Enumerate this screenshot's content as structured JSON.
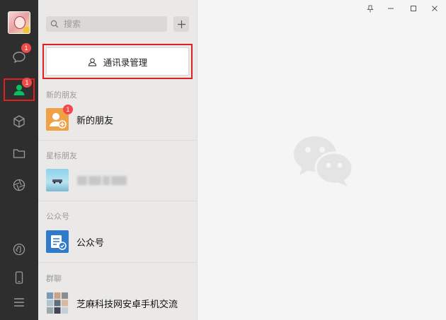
{
  "rail": {
    "items": [
      {
        "name": "chat",
        "badge": "1"
      },
      {
        "name": "contacts",
        "badge": "1",
        "active": true
      },
      {
        "name": "collections"
      },
      {
        "name": "files"
      },
      {
        "name": "moments"
      },
      {
        "name": "mini-programs"
      },
      {
        "name": "phone"
      },
      {
        "name": "menu"
      }
    ]
  },
  "search": {
    "placeholder": "搜索"
  },
  "manage_button": {
    "label": "通讯录管理"
  },
  "sections": [
    {
      "title": "新的朋友",
      "items": [
        {
          "label": "新的朋友",
          "badge": "1"
        }
      ]
    },
    {
      "title": "星标朋友",
      "items": [
        {
          "label": ""
        }
      ]
    },
    {
      "title": "公众号",
      "items": [
        {
          "label": "公众号"
        }
      ]
    },
    {
      "title": "群聊",
      "items": [
        {
          "label": "芝麻科技网安卓手机交流"
        }
      ]
    }
  ],
  "colors": {
    "accent_green": "#07c160",
    "highlight_red": "#e02020",
    "badge_red": "#f04a4a"
  }
}
